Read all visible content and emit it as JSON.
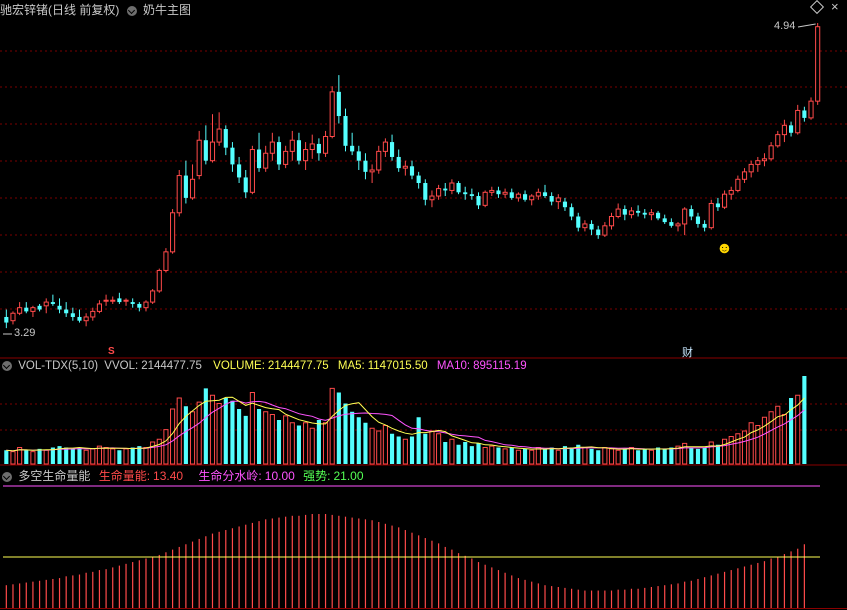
{
  "header": {
    "stock_title": "驰宏锌锗(日线 前复权)",
    "indicator_name": "奶牛主图"
  },
  "price_panel": {
    "high_label": "4.94",
    "low_label": "3.29",
    "marker_s": "S",
    "marker_cai": "财",
    "smiley": "☻",
    "colors": {
      "up": "#ff4a4a",
      "down": "#54ffff",
      "grid": "#7a0000"
    }
  },
  "volume_panel": {
    "title": "VOL-TDX(5,10)",
    "vvol_label": "VVOL:",
    "vvol_value": "2144477.75",
    "volume_label": "VOLUME:",
    "volume_value": "2144477.75",
    "ma5_label": "MA5:",
    "ma5_value": "1147015.50",
    "ma10_label": "MA10:",
    "ma10_value": "895115.19",
    "colors": {
      "ma5": "#ffff54",
      "ma10": "#ff54ff",
      "volume": "#ffff54"
    }
  },
  "energy_panel": {
    "title": "多空生命量能",
    "energy_label": "生命量能:",
    "energy_value": "13.40",
    "divide_label": "生命分水岭:",
    "divide_value": "10.00",
    "strength_label": "强势:",
    "strength_value": "21.00",
    "colors": {
      "energy": "#ff4a4a",
      "divide": "#ff54ff",
      "strength": "#54ff54",
      "baseline": "#ffff54"
    }
  },
  "chart_data": {
    "type": "candlestick",
    "price_range": [
      3.29,
      4.94
    ],
    "candles": [
      [
        3.36,
        3.4,
        3.3,
        3.33
      ],
      [
        3.34,
        3.39,
        3.32,
        3.38
      ],
      [
        3.38,
        3.44,
        3.37,
        3.41
      ],
      [
        3.41,
        3.44,
        3.38,
        3.39
      ],
      [
        3.39,
        3.42,
        3.36,
        3.41
      ],
      [
        3.42,
        3.43,
        3.39,
        3.4
      ],
      [
        3.42,
        3.46,
        3.38,
        3.44
      ],
      [
        3.44,
        3.48,
        3.42,
        3.43
      ],
      [
        3.42,
        3.46,
        3.38,
        3.4
      ],
      [
        3.4,
        3.44,
        3.36,
        3.38
      ],
      [
        3.38,
        3.41,
        3.34,
        3.36
      ],
      [
        3.36,
        3.4,
        3.33,
        3.34
      ],
      [
        3.34,
        3.38,
        3.31,
        3.36
      ],
      [
        3.36,
        3.41,
        3.34,
        3.39
      ],
      [
        3.39,
        3.45,
        3.38,
        3.43
      ],
      [
        3.45,
        3.48,
        3.42,
        3.45
      ],
      [
        3.45,
        3.47,
        3.43,
        3.45
      ],
      [
        3.46,
        3.49,
        3.43,
        3.44
      ],
      [
        3.45,
        3.46,
        3.42,
        3.45
      ],
      [
        3.44,
        3.46,
        3.41,
        3.43
      ],
      [
        3.43,
        3.44,
        3.39,
        3.41
      ],
      [
        3.41,
        3.45,
        3.39,
        3.44
      ],
      [
        3.44,
        3.51,
        3.43,
        3.5
      ],
      [
        3.5,
        3.62,
        3.49,
        3.61
      ],
      [
        3.61,
        3.73,
        3.6,
        3.71
      ],
      [
        3.71,
        3.94,
        3.7,
        3.92
      ],
      [
        3.92,
        4.15,
        3.9,
        4.12
      ],
      [
        4.12,
        4.2,
        3.97,
        4.0
      ],
      [
        4.0,
        4.18,
        3.99,
        4.1
      ],
      [
        4.12,
        4.36,
        4.1,
        4.31
      ],
      [
        4.31,
        4.39,
        4.18,
        4.2
      ],
      [
        4.2,
        4.45,
        4.19,
        4.3
      ],
      [
        4.3,
        4.46,
        4.28,
        4.37
      ],
      [
        4.37,
        4.39,
        4.23,
        4.27
      ],
      [
        4.27,
        4.3,
        4.14,
        4.18
      ],
      [
        4.18,
        4.22,
        4.08,
        4.11
      ],
      [
        4.11,
        4.15,
        4.0,
        4.03
      ],
      [
        4.03,
        4.28,
        4.02,
        4.26
      ],
      [
        4.26,
        4.35,
        4.14,
        4.16
      ],
      [
        4.16,
        4.28,
        4.14,
        4.24
      ],
      [
        4.24,
        4.35,
        4.2,
        4.3
      ],
      [
        4.3,
        4.33,
        4.15,
        4.18
      ],
      [
        4.18,
        4.28,
        4.16,
        4.25
      ],
      [
        4.25,
        4.36,
        4.2,
        4.31
      ],
      [
        4.31,
        4.35,
        4.18,
        4.2
      ],
      [
        4.2,
        4.3,
        4.15,
        4.26
      ],
      [
        4.26,
        4.34,
        4.21,
        4.29
      ],
      [
        4.29,
        4.32,
        4.2,
        4.24
      ],
      [
        4.24,
        4.36,
        4.22,
        4.33
      ],
      [
        4.33,
        4.6,
        4.32,
        4.57
      ],
      [
        4.57,
        4.66,
        4.4,
        4.44
      ],
      [
        4.44,
        4.48,
        4.25,
        4.28
      ],
      [
        4.28,
        4.35,
        4.23,
        4.25
      ],
      [
        4.25,
        4.28,
        4.15,
        4.2
      ],
      [
        4.2,
        4.24,
        4.1,
        4.14
      ],
      [
        4.14,
        4.18,
        4.08,
        4.15
      ],
      [
        4.15,
        4.28,
        4.13,
        4.25
      ],
      [
        4.25,
        4.32,
        4.22,
        4.3
      ],
      [
        4.3,
        4.34,
        4.2,
        4.22
      ],
      [
        4.22,
        4.26,
        4.14,
        4.16
      ],
      [
        4.16,
        4.2,
        4.12,
        4.17
      ],
      [
        4.17,
        4.2,
        4.1,
        4.12
      ],
      [
        4.12,
        4.14,
        4.05,
        4.08
      ],
      [
        4.08,
        4.1,
        3.96,
        3.99
      ],
      [
        3.99,
        4.04,
        3.95,
        4.01
      ],
      [
        4.01,
        4.07,
        3.99,
        4.05
      ],
      [
        4.05,
        4.08,
        4.01,
        4.04
      ],
      [
        4.04,
        4.1,
        4.02,
        4.08
      ],
      [
        4.08,
        4.09,
        4.02,
        4.03
      ],
      [
        4.03,
        4.06,
        3.99,
        4.02
      ],
      [
        4.02,
        4.05,
        3.99,
        4.01
      ],
      [
        4.01,
        4.03,
        3.94,
        3.96
      ],
      [
        3.96,
        4.04,
        3.95,
        4.03
      ],
      [
        4.03,
        4.06,
        4.01,
        4.04
      ],
      [
        4.04,
        4.06,
        4.0,
        4.02
      ],
      [
        4.02,
        4.05,
        4.0,
        4.03
      ],
      [
        4.03,
        4.05,
        3.99,
        4.0
      ],
      [
        4.0,
        4.03,
        3.98,
        4.02
      ],
      [
        4.02,
        4.04,
        3.98,
        3.99
      ],
      [
        3.99,
        4.02,
        3.96,
        4.01
      ],
      [
        4.01,
        4.05,
        3.99,
        4.03
      ],
      [
        4.03,
        4.07,
        4.0,
        4.01
      ],
      [
        4.01,
        4.03,
        3.96,
        3.98
      ],
      [
        3.98,
        4.02,
        3.94,
        4.0
      ],
      [
        3.98,
        4.0,
        3.93,
        3.95
      ],
      [
        3.95,
        3.97,
        3.88,
        3.9
      ],
      [
        3.9,
        3.92,
        3.82,
        3.84
      ],
      [
        3.84,
        3.88,
        3.82,
        3.86
      ],
      [
        3.86,
        3.88,
        3.8,
        3.83
      ],
      [
        3.83,
        3.85,
        3.78,
        3.8
      ],
      [
        3.8,
        3.87,
        3.79,
        3.85
      ],
      [
        3.85,
        3.92,
        3.83,
        3.9
      ],
      [
        3.9,
        3.97,
        3.89,
        3.94
      ],
      [
        3.94,
        3.96,
        3.88,
        3.91
      ],
      [
        3.91,
        3.95,
        3.89,
        3.93
      ],
      [
        3.93,
        3.96,
        3.9,
        3.92
      ],
      [
        3.92,
        3.94,
        3.89,
        3.91
      ],
      [
        3.91,
        3.94,
        3.88,
        3.92
      ],
      [
        3.92,
        3.93,
        3.88,
        3.89
      ],
      [
        3.89,
        3.91,
        3.86,
        3.87
      ],
      [
        3.87,
        3.89,
        3.84,
        3.85
      ],
      [
        3.85,
        3.87,
        3.82,
        3.86
      ],
      [
        3.86,
        3.95,
        3.8,
        3.94
      ],
      [
        3.94,
        3.96,
        3.88,
        3.9
      ],
      [
        3.9,
        3.92,
        3.84,
        3.86
      ],
      [
        3.86,
        3.88,
        3.82,
        3.84
      ],
      [
        3.84,
        3.99,
        3.83,
        3.97
      ],
      [
        3.97,
        4.0,
        3.93,
        3.95
      ],
      [
        3.95,
        4.04,
        3.94,
        4.02
      ],
      [
        4.02,
        4.06,
        3.99,
        4.04
      ],
      [
        4.04,
        4.12,
        4.03,
        4.1
      ],
      [
        4.1,
        4.16,
        4.08,
        4.14
      ],
      [
        4.14,
        4.2,
        4.11,
        4.18
      ],
      [
        4.18,
        4.22,
        4.14,
        4.2
      ],
      [
        4.2,
        4.24,
        4.17,
        4.21
      ],
      [
        4.21,
        4.3,
        4.2,
        4.28
      ],
      [
        4.28,
        4.36,
        4.27,
        4.34
      ],
      [
        4.34,
        4.42,
        4.3,
        4.39
      ],
      [
        4.39,
        4.41,
        4.33,
        4.35
      ],
      [
        4.35,
        4.5,
        4.34,
        4.47
      ],
      [
        4.47,
        4.49,
        4.41,
        4.43
      ],
      [
        4.43,
        4.54,
        4.42,
        4.52
      ],
      [
        4.52,
        4.94,
        4.5,
        4.92
      ]
    ],
    "volume": [
      0.1,
      0.09,
      0.12,
      0.1,
      0.09,
      0.11,
      0.1,
      0.12,
      0.13,
      0.12,
      0.11,
      0.12,
      0.1,
      0.11,
      0.13,
      0.12,
      0.11,
      0.1,
      0.11,
      0.12,
      0.13,
      0.12,
      0.16,
      0.18,
      0.25,
      0.4,
      0.48,
      0.42,
      0.38,
      0.45,
      0.55,
      0.5,
      0.44,
      0.48,
      0.46,
      0.4,
      0.35,
      0.52,
      0.4,
      0.38,
      0.36,
      0.32,
      0.35,
      0.3,
      0.28,
      0.3,
      0.26,
      0.32,
      0.3,
      0.55,
      0.52,
      0.44,
      0.38,
      0.34,
      0.3,
      0.26,
      0.24,
      0.28,
      0.22,
      0.2,
      0.18,
      0.2,
      0.34,
      0.22,
      0.24,
      0.22,
      0.16,
      0.18,
      0.14,
      0.16,
      0.13,
      0.15,
      0.12,
      0.13,
      0.12,
      0.11,
      0.12,
      0.1,
      0.11,
      0.1,
      0.12,
      0.11,
      0.12,
      0.1,
      0.13,
      0.12,
      0.14,
      0.12,
      0.11,
      0.1,
      0.12,
      0.11,
      0.1,
      0.11,
      0.12,
      0.1,
      0.11,
      0.1,
      0.12,
      0.11,
      0.12,
      0.13,
      0.15,
      0.12,
      0.11,
      0.12,
      0.16,
      0.14,
      0.18,
      0.2,
      0.22,
      0.24,
      0.3,
      0.28,
      0.34,
      0.38,
      0.42,
      0.36,
      0.48,
      0.5,
      0.64
    ],
    "energy": [
      0.2,
      0.21,
      0.22,
      0.23,
      0.24,
      0.25,
      0.26,
      0.27,
      0.28,
      0.3,
      0.31,
      0.32,
      0.34,
      0.35,
      0.37,
      0.38,
      0.4,
      0.42,
      0.44,
      0.46,
      0.48,
      0.5,
      0.52,
      0.54,
      0.57,
      0.6,
      0.63,
      0.66,
      0.69,
      0.72,
      0.75,
      0.78,
      0.8,
      0.82,
      0.84,
      0.86,
      0.88,
      0.9,
      0.92,
      0.94,
      0.95,
      0.96,
      0.97,
      0.98,
      0.98,
      0.99,
      1.0,
      1.0,
      1.0,
      0.99,
      0.98,
      0.97,
      0.96,
      0.95,
      0.94,
      0.93,
      0.91,
      0.89,
      0.87,
      0.85,
      0.82,
      0.79,
      0.76,
      0.73,
      0.7,
      0.67,
      0.63,
      0.6,
      0.56,
      0.53,
      0.5,
      0.46,
      0.43,
      0.4,
      0.37,
      0.34,
      0.31,
      0.28,
      0.26,
      0.24,
      0.22,
      0.2,
      0.19,
      0.18,
      0.17,
      0.16,
      0.15,
      0.14,
      0.14,
      0.14,
      0.14,
      0.14,
      0.15,
      0.15,
      0.16,
      0.16,
      0.17,
      0.18,
      0.19,
      0.2,
      0.21,
      0.22,
      0.24,
      0.25,
      0.27,
      0.29,
      0.31,
      0.33,
      0.35,
      0.37,
      0.39,
      0.41,
      0.43,
      0.45,
      0.47,
      0.5,
      0.52,
      0.55,
      0.58,
      0.61,
      0.66
    ]
  }
}
